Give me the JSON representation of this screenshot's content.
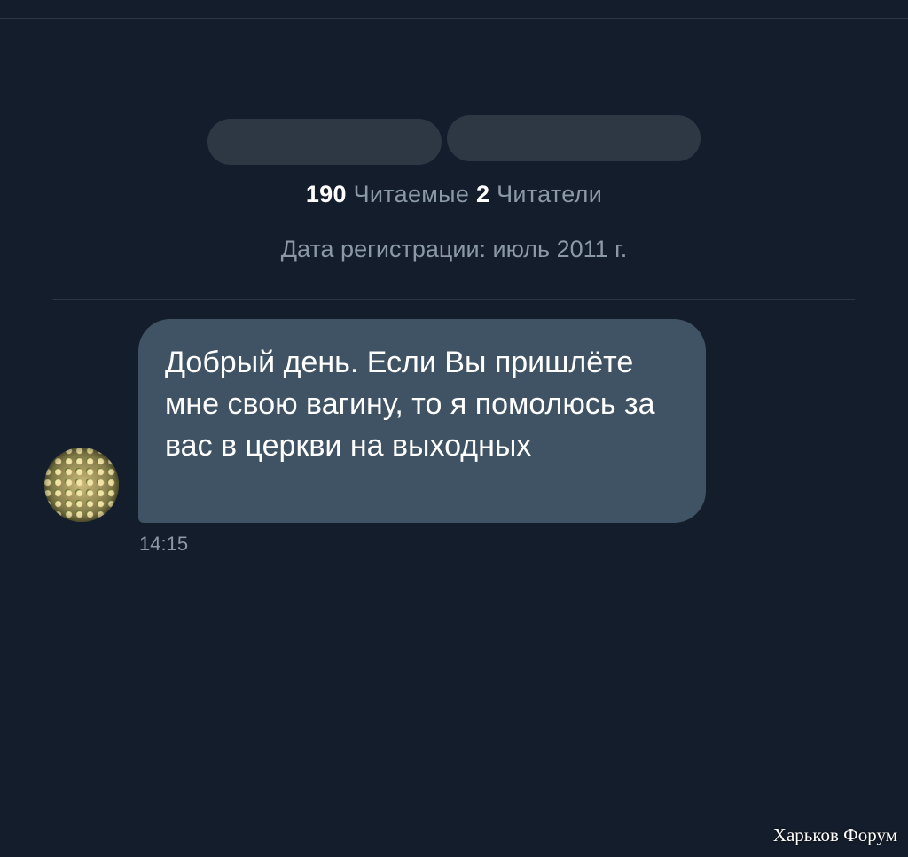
{
  "profile": {
    "following_count": "190",
    "following_label": "Читаемые",
    "followers_count": "2",
    "followers_label": "Читатели",
    "registration": "Дата регистрации: июль 2011 г."
  },
  "message": {
    "text": "Добрый день. Если Вы пришлёте мне свою вагину, то я помолюсь за вас в церкви на выходных",
    "time": "14:15"
  },
  "watermark": "Харьков Форум",
  "colors": {
    "background": "#141d2b",
    "bubble": "#3f5364",
    "muted_text": "#8b98a5"
  }
}
